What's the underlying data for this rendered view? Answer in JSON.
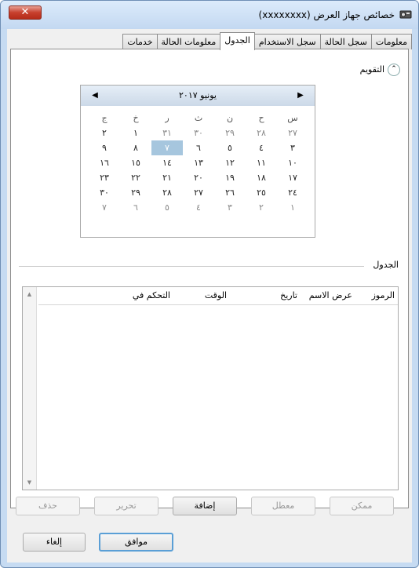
{
  "window": {
    "title": "خصائص جهاز العرض (xxxxxxxx)",
    "close_glyph": "✕"
  },
  "tabs": [
    "معلومات",
    "سجل الحالة",
    "سجل الاستخدام",
    "الجدول",
    "معلومات الحالة",
    "خدمات"
  ],
  "active_tab": "الجدول",
  "calendar_section": {
    "label": "التقويم",
    "toggle_glyph": "⌃"
  },
  "calendar": {
    "month": "يونيو ٢٠١٧",
    "prev_glyph": "◀",
    "next_glyph": "▶",
    "day_names": [
      "س",
      "ح",
      "ن",
      "ث",
      "ر",
      "خ",
      "ج"
    ],
    "weeks": [
      [
        "٢٧",
        "٢٨",
        "٢٩",
        "٣٠",
        "٣١",
        "١",
        "٢"
      ],
      [
        "٣",
        "٤",
        "٥",
        "٦",
        "٧",
        "٨",
        "٩"
      ],
      [
        "١٠",
        "١١",
        "١٢",
        "١٣",
        "١٤",
        "١٥",
        "١٦"
      ],
      [
        "١٧",
        "١٨",
        "١٩",
        "٢٠",
        "٢١",
        "٢٢",
        "٢٣"
      ],
      [
        "٢٤",
        "٢٥",
        "٢٦",
        "٢٧",
        "٢٨",
        "٢٩",
        "٣٠"
      ],
      [
        "١",
        "٢",
        "٣",
        "٤",
        "٥",
        "٦",
        "٧"
      ]
    ],
    "selected_day": "٧"
  },
  "schedule": {
    "label": "الجدول",
    "columns": [
      "الرموز",
      "عرض الاسم",
      "تاريخ",
      "الوقت",
      "التحكم في"
    ]
  },
  "schedule_buttons": {
    "enable": "ممكن",
    "disable": "معطل",
    "add": "إضافة",
    "edit": "تحرير",
    "delete": "حذف"
  },
  "dialog_buttons": {
    "ok": "موافق",
    "cancel": "إلغاء"
  },
  "colors": {
    "title_bar": "#c3d8f1",
    "selected_day": "#a6c6de",
    "close_button": "#c7402d"
  }
}
